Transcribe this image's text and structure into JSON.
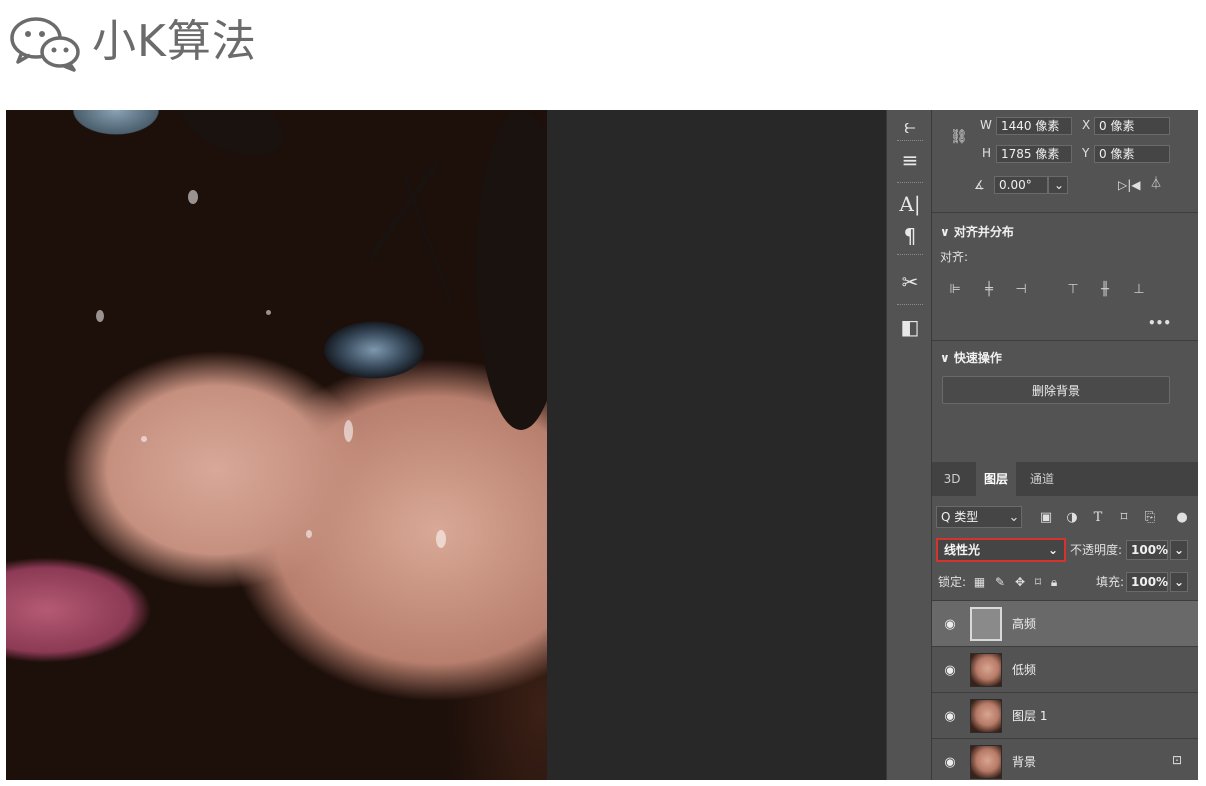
{
  "brand": {
    "name": "小K算法",
    "icon": "wechat-icon"
  },
  "transform": {
    "w_label": "W",
    "w_value": "1440 像素",
    "h_label": "H",
    "h_value": "1785 像素",
    "x_label": "X",
    "x_value": "0 像素",
    "y_label": "Y",
    "y_value": "0 像素",
    "angle_value": "0.00°"
  },
  "align_section": {
    "title": "∨ 对齐并分布",
    "align_label": "对齐:",
    "more": "•••"
  },
  "quick_actions": {
    "title": "∨ 快速操作",
    "remove_bg_label": "删除背景"
  },
  "layers_panel": {
    "tabs": [
      {
        "label": "3D",
        "active": false
      },
      {
        "label": "图层",
        "active": true
      },
      {
        "label": "通道",
        "active": false
      }
    ],
    "filter_label": "Q 类型",
    "blend_mode": "线性光",
    "opacity_label": "不透明度:",
    "opacity_value": "100%",
    "lock_label": "锁定:",
    "fill_label": "填充:",
    "fill_value": "100%",
    "layers": [
      {
        "name": "高频",
        "thumb": "gray",
        "selected": true,
        "locked": false
      },
      {
        "name": "低频",
        "thumb": "face",
        "selected": false,
        "locked": false
      },
      {
        "name": "图层 1",
        "thumb": "face",
        "selected": false,
        "locked": false
      },
      {
        "name": "背景",
        "thumb": "face",
        "selected": false,
        "locked": true
      }
    ]
  },
  "colors": {
    "highlight": "#d6332f",
    "panel": "#535353",
    "canvas": "#282828"
  }
}
